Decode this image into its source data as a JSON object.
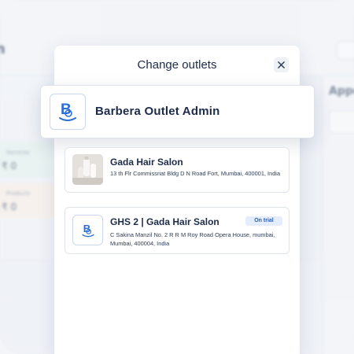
{
  "modal": {
    "title": "Change outlets",
    "close_icon": "close-icon"
  },
  "current_outlet": {
    "name": "Barbera Outlet Admin",
    "logo_icon": "barbera-logo-icon"
  },
  "outlets": [
    {
      "name": "Gada Hair Salon",
      "address": "13 th Flr  Commissriat Bldg D N Road Fort, Mumbai, 400001, India",
      "thumbnail": "salon-photo"
    },
    {
      "name": "GHS 2 | Gada Hair Salon",
      "address": "C Sakina Manzil No. 2 R R M Roy Road Opera House, mumbai, Mumbai, 400004, India",
      "badge": "On trial",
      "logo_icon": "barbera-logo-icon"
    }
  ],
  "colors": {
    "brand_blue": "#2d6fd6",
    "title_text": "#1c2b4a",
    "badge_bg": "#e3edfb"
  }
}
